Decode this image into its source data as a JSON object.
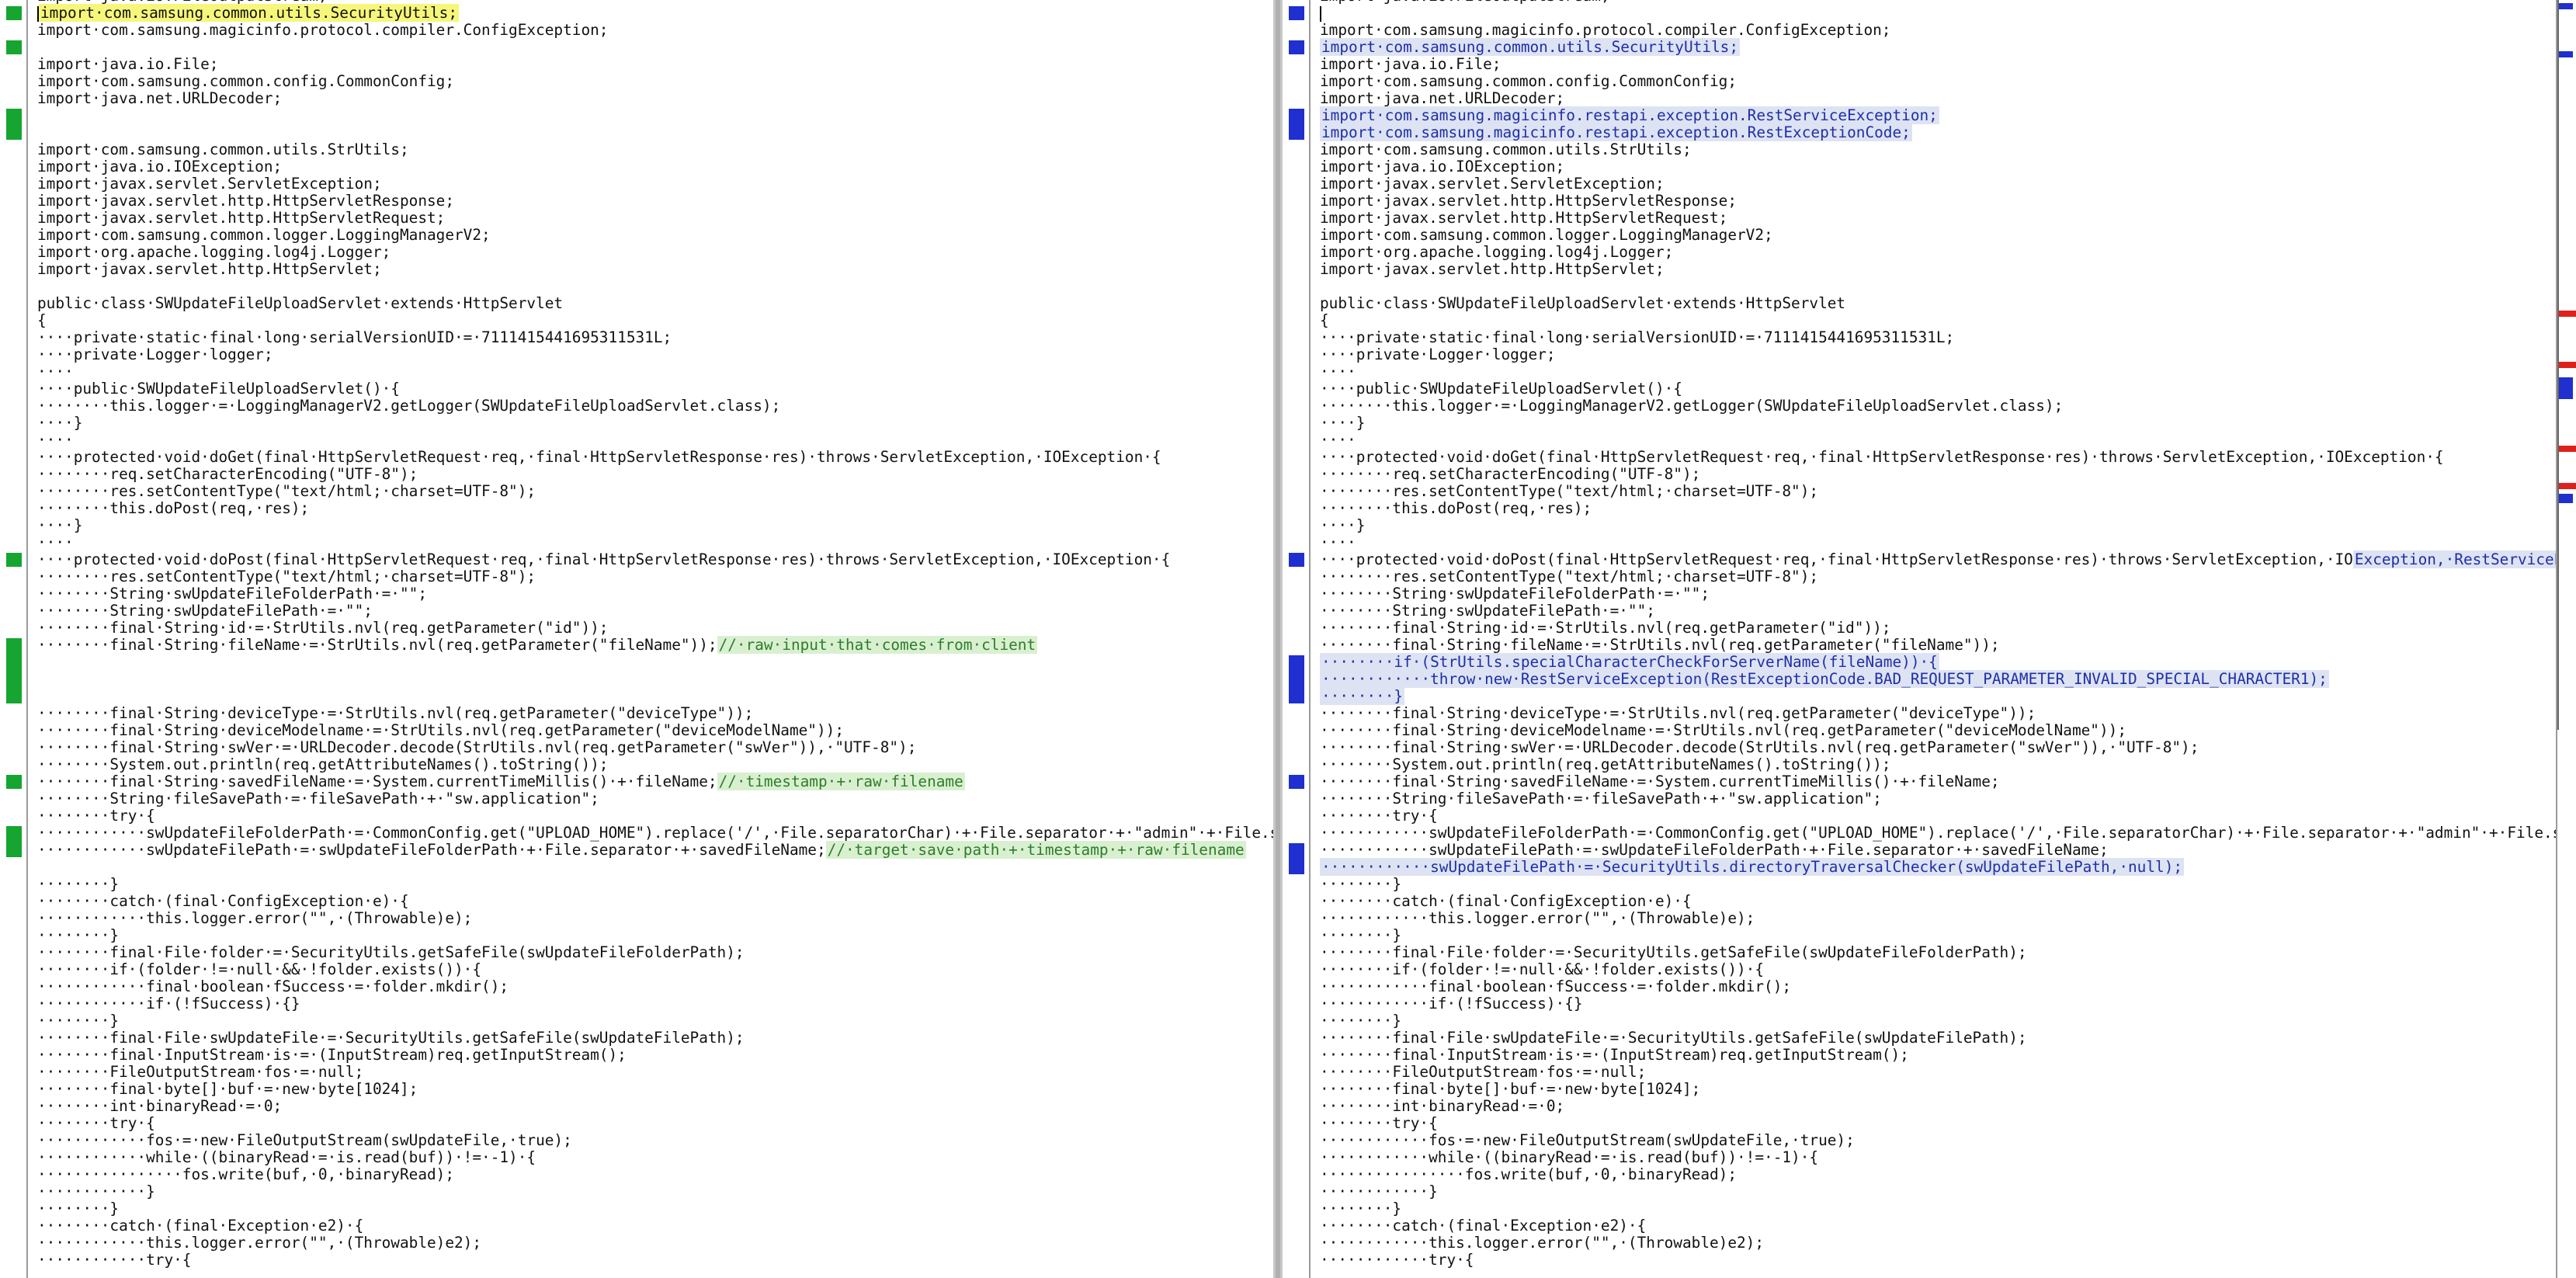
{
  "left": {
    "lines": [
      "import·java.io.FileOutputStream;",
      "import·com.samsung.common.utils.SecurityUtils;",
      "import·com.samsung.magicinfo.protocol.compiler.ConfigException;",
      "",
      "import·java.io.File;",
      "import·com.samsung.common.config.CommonConfig;",
      "import·java.net.URLDecoder;",
      "",
      "",
      "import·com.samsung.common.utils.StrUtils;",
      "import·java.io.IOException;",
      "import·javax.servlet.ServletException;",
      "import·javax.servlet.http.HttpServletResponse;",
      "import·javax.servlet.http.HttpServletRequest;",
      "import·com.samsung.common.logger.LoggingManagerV2;",
      "import·org.apache.logging.log4j.Logger;",
      "import·javax.servlet.http.HttpServlet;",
      "",
      "public·class·SWUpdateFileUploadServlet·extends·HttpServlet",
      "{",
      "····private·static·final·long·serialVersionUID·=·7111415441695311531L;",
      "····private·Logger·logger;",
      "····",
      "····public·SWUpdateFileUploadServlet()·{",
      "········this.logger·=·LoggingManagerV2.getLogger(SWUpdateFileUploadServlet.class);",
      "····}",
      "····",
      "····protected·void·doGet(final·HttpServletRequest·req,·final·HttpServletResponse·res)·throws·ServletException,·IOException·{",
      "········req.setCharacterEncoding(\"UTF-8\");",
      "········res.setContentType(\"text/html;·charset=UTF-8\");",
      "········this.doPost(req,·res);",
      "····}",
      "····",
      "····protected·void·doPost(final·HttpServletRequest·req,·final·HttpServletResponse·res)·throws·ServletException,·IOException·{",
      "········res.setContentType(\"text/html;·charset=UTF-8\");",
      "········String·swUpdateFileFolderPath·=·\"\";",
      "········String·swUpdateFilePath·=·\"\";",
      "········final·String·id·=·StrUtils.nvl(req.getParameter(\"id\"));",
      "········final·String·fileName·=·StrUtils.nvl(req.getParameter(\"fileName\"));",
      "",
      "",
      "",
      "········final·String·deviceType·=·StrUtils.nvl(req.getParameter(\"deviceType\"));",
      "········final·String·deviceModelname·=·StrUtils.nvl(req.getParameter(\"deviceModelName\"));",
      "········final·String·swVer·=·URLDecoder.decode(StrUtils.nvl(req.getParameter(\"swVer\")),·\"UTF-8\");",
      "········System.out.println(req.getAttributeNames().toString());",
      "········final·String·savedFileName·=·System.currentTimeMillis()·+·fileName;",
      "········String·fileSavePath·=·fileSavePath·+·\"sw.application\";",
      "········try·{",
      "············swUpdateFileFolderPath·=·CommonConfig.get(\"UPLOAD_HOME\").replace('/',·File.separatorChar)·+·File.separator·+·\"admin\"·+·File.separator·+·\"sw\";",
      "············swUpdateFilePath·=·swUpdateFileFolderPath·+·File.separator·+·savedFileName;",
      "",
      "········}",
      "········catch·(final·ConfigException·e)·{",
      "············this.logger.error(\"\",·(Throwable)e);",
      "········}",
      "········final·File·folder·=·SecurityUtils.getSafeFile(swUpdateFileFolderPath);",
      "········if·(folder·!=·null·&&·!folder.exists())·{",
      "············final·boolean·fSuccess·=·folder.mkdir();",
      "············if·(!fSuccess)·{}",
      "········}",
      "········final·File·swUpdateFile·=·SecurityUtils.getSafeFile(swUpdateFilePath);",
      "········final·InputStream·is·=·(InputStream)req.getInputStream();",
      "········FileOutputStream·fos·=·null;",
      "········final·byte[]·buf·=·new·byte[1024];",
      "········int·binaryRead·=·0;",
      "········try·{",
      "············fos·=·new·FileOutputStream(swUpdateFile,·true);",
      "············while·((binaryRead·=·is.read(buf))·!=·-1)·{",
      "················fos.write(buf,·0,·binaryRead);",
      "············}",
      "········}",
      "········catch·(final·Exception·e2)·{",
      "············this.logger.error(\"\",·(Throwable)e2);",
      "············try·{"
    ],
    "comments": {
      "fileName": "//·raw·input·that·comes·from·client",
      "savedFileName": "//·timestamp·+·raw·filename",
      "savePath": "//·target·save·path·+·timestamp·+·raw·filename"
    }
  },
  "right": {
    "lines": [
      "import·java.io.FileOutputStream;",
      "",
      "import·com.samsung.magicinfo.protocol.compiler.ConfigException;",
      "import·com.samsung.common.utils.SecurityUtils;",
      "import·java.io.File;",
      "import·com.samsung.common.config.CommonConfig;",
      "import·java.net.URLDecoder;",
      "import·com.samsung.magicinfo.restapi.exception.RestServiceException;",
      "import·com.samsung.magicinfo.restapi.exception.RestExceptionCode;",
      "import·com.samsung.common.utils.StrUtils;",
      "import·java.io.IOException;",
      "import·javax.servlet.ServletException;",
      "import·javax.servlet.http.HttpServletResponse;",
      "import·javax.servlet.http.HttpServletRequest;",
      "import·com.samsung.common.logger.LoggingManagerV2;",
      "import·org.apache.logging.log4j.Logger;",
      "import·javax.servlet.http.HttpServlet;",
      "",
      "public·class·SWUpdateFileUploadServlet·extends·HttpServlet",
      "{",
      "····private·static·final·long·serialVersionUID·=·7111415441695311531L;",
      "····private·Logger·logger;",
      "····",
      "····public·SWUpdateFileUploadServlet()·{",
      "········this.logger·=·LoggingManagerV2.getLogger(SWUpdateFileUploadServlet.class);",
      "····}",
      "····",
      "····protected·void·doGet(final·HttpServletRequest·req,·final·HttpServletResponse·res)·throws·ServletException,·IOException·{",
      "········req.setCharacterEncoding(\"UTF-8\");",
      "········res.setContentType(\"text/html;·charset=UTF-8\");",
      "········this.doPost(req,·res);",
      "····}",
      "····",
      "····protected·void·doPost(final·HttpServletRequest·req,·final·HttpServletResponse·res)·throws·ServletException,·IO",
      "········res.setContentType(\"text/html;·charset=UTF-8\");",
      "········String·swUpdateFileFolderPath·=·\"\";",
      "········String·swUpdateFilePath·=·\"\";",
      "········final·String·id·=·StrUtils.nvl(req.getParameter(\"id\"));",
      "········final·String·fileName·=·StrUtils.nvl(req.getParameter(\"fileName\"));",
      "········if·(StrUtils.specialCharacterCheckForServerName(fileName))·{",
      "············throw·new·RestServiceException(RestExceptionCode.BAD_REQUEST_PARAMETER_INVALID_SPECIAL_CHARACTER1);",
      "········}",
      "········final·String·deviceType·=·StrUtils.nvl(req.getParameter(\"deviceType\"));",
      "········final·String·deviceModelname·=·StrUtils.nvl(req.getParameter(\"deviceModelName\"));",
      "········final·String·swVer·=·URLDecoder.decode(StrUtils.nvl(req.getParameter(\"swVer\")),·\"UTF-8\");",
      "········System.out.println(req.getAttributeNames().toString());",
      "········final·String·savedFileName·=·System.currentTimeMillis()·+·fileName;",
      "········String·fileSavePath·=·fileSavePath·+·\"sw.application\";",
      "········try·{",
      "············swUpdateFileFolderPath·=·CommonConfig.get(\"UPLOAD_HOME\").replace('/',·File.separatorChar)·+·File.separator·+·\"admin\"·+·File.separator·+·\"sw\";",
      "············swUpdateFilePath·=·swUpdateFileFolderPath·+·File.separator·+·savedFileName;",
      "············swUpdateFilePath·=·SecurityUtils.directoryTraversalChecker(swUpdateFilePath,·null);",
      "········}",
      "········catch·(final·ConfigException·e)·{",
      "············this.logger.error(\"\",·(Throwable)e);",
      "········}",
      "········final·File·folder·=·SecurityUtils.getSafeFile(swUpdateFileFolderPath);",
      "········if·(folder·!=·null·&&·!folder.exists())·{",
      "············final·boolean·fSuccess·=·folder.mkdir();",
      "············if·(!fSuccess)·{}",
      "········}",
      "········final·File·swUpdateFile·=·SecurityUtils.getSafeFile(swUpdateFilePath);",
      "········final·InputStream·is·=·(InputStream)req.getInputStream();",
      "········FileOutputStream·fos·=·null;",
      "········final·byte[]·buf·=·new·byte[1024];",
      "········int·binaryRead·=·0;",
      "········try·{",
      "············fos·=·new·FileOutputStream(swUpdateFile,·true);",
      "············while·((binaryRead·=·is.read(buf))·!=·-1)·{",
      "················fos.write(buf,·0,·binaryRead);",
      "············}",
      "········}",
      "········catch·(final·Exception·e2)·{",
      "············this.logger.error(\"\",·(Throwable)e2);",
      "············try·{"
    ],
    "doPostTail": "Exception,·RestServiceException·{"
  },
  "colors": {
    "added": "#1f2fd0",
    "removed": "#15a530",
    "changed_minimap": "#e0201a",
    "highlight": "#f6f77a"
  }
}
